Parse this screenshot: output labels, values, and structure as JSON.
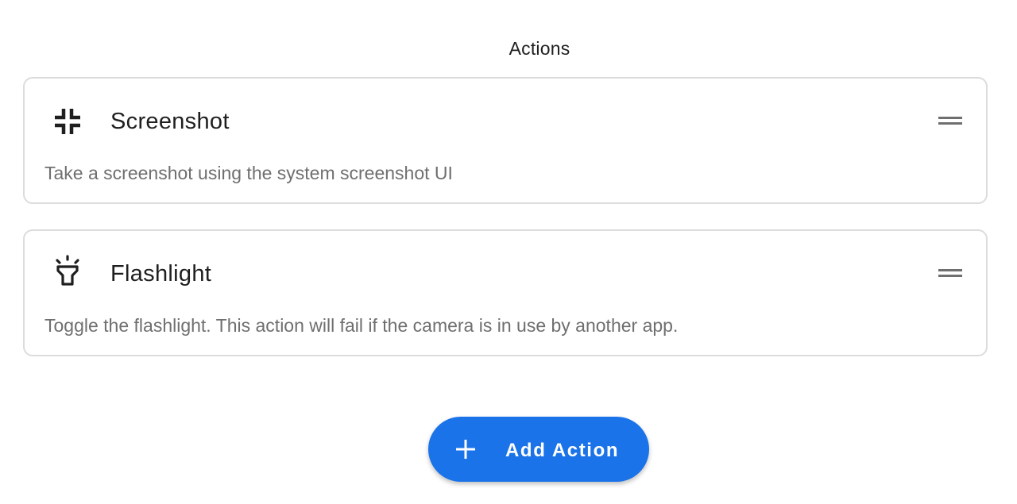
{
  "section": {
    "title": "Actions"
  },
  "actions": [
    {
      "icon": "fullscreen-exit-icon",
      "title": "Screenshot",
      "description": "Take a screenshot using the system screenshot UI"
    },
    {
      "icon": "flashlight-icon",
      "title": "Flashlight",
      "description": "Toggle the flashlight. This action will fail if the camera is in use by another app."
    }
  ],
  "add_button": {
    "label": "Add Action",
    "icon": "plus-icon"
  },
  "colors": {
    "accent": "#1a73e8",
    "card_border": "#dcdcdc",
    "title_text": "#1f1f1f",
    "description_text": "#6f6f6f"
  }
}
